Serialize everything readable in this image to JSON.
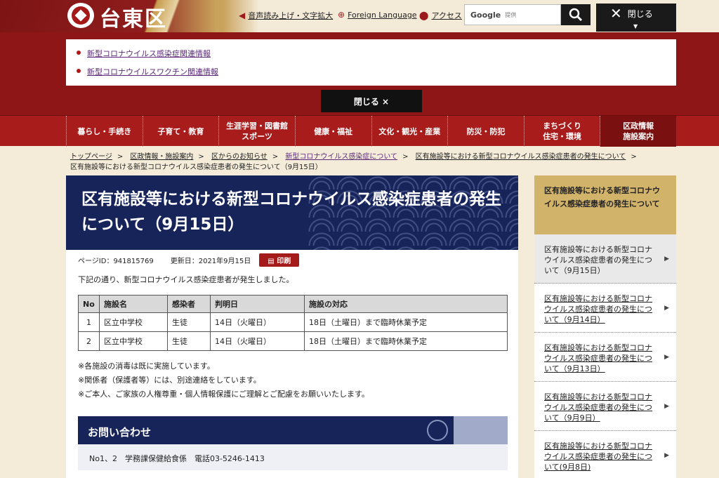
{
  "header": {
    "logo_text": "台東区",
    "util_voice": "音声読み上げ・文字拡大",
    "util_lang": "Foreign Language",
    "util_access": "アクセス",
    "search_brand": "Google",
    "search_sub": "提供",
    "close_label": "閉じる"
  },
  "notice": {
    "items": [
      "新型コロナウイルス感染症関連情報",
      "新型コロナウイルスワクチン関連情報"
    ],
    "close_label": "閉じる ×"
  },
  "nav": {
    "items": [
      "暮らし・手続き",
      "子育て・教育",
      "生涯学習・図書館\nスポーツ",
      "健康・福祉",
      "文化・観光・産業",
      "防災・防犯",
      "まちづくり\n住宅・環境",
      "区政情報\n施設案内"
    ]
  },
  "breadcrumb": {
    "items": [
      "トップページ",
      "区政情報・施設案内",
      "区からのお知らせ",
      "新型コロナウイルス感染症について",
      "区有施設等における新型コロナウイルス感染症患者の発生について"
    ],
    "current": "区有施設等における新型コロナウイルス感染症患者の発生について（9月15日）"
  },
  "article": {
    "title": "区有施設等における新型コロナウイルス感染症患者の発生について（9月15日）",
    "page_id": "ページID：941815769",
    "updated": "更新日：2021年9月15日",
    "print_label": "印刷",
    "intro": "下記の通り、新型コロナウイルス感染症患者が発生しました。",
    "table": {
      "headers": [
        "No",
        "施設名",
        "感染者",
        "判明日",
        "施設の対応"
      ],
      "rows": [
        [
          "1",
          "区立中学校",
          "生徒",
          "14日（火曜日）",
          "18日（土曜日）まで臨時休業予定"
        ],
        [
          "2",
          "区立中学校",
          "生徒",
          "14日（火曜日）",
          "18日（土曜日）まで臨時休業予定"
        ]
      ]
    },
    "notes": [
      "※各施設の消毒は既に実施しています。",
      "※関係者（保護者等）には、別途連絡をしています。",
      "※ご本人、ご家族の人権尊重・個人情報保護にご理解とご配慮をお願いいたします。"
    ],
    "contact_heading": "お問い合わせ",
    "contact_body": "No1、2　学務課保健給食係　電話03-5246-1413"
  },
  "sidebar": {
    "heading": "区有施設等における新型コロナウイルス感染症患者の発生について",
    "items": [
      "区有施設等における新型コロナウイルス感染症患者の発生について（9月15日）",
      "区有施設等における新型コロナウイルス感染症患者の発生について（9月14日）",
      "区有施設等における新型コロナウイルス感染症患者の発生について（9月13日）",
      "区有施設等における新型コロナウイルス感染症患者の発生について（9月9日）",
      "区有施設等における新型コロナウイルス感染症患者の発生について(9月8日)"
    ]
  }
}
